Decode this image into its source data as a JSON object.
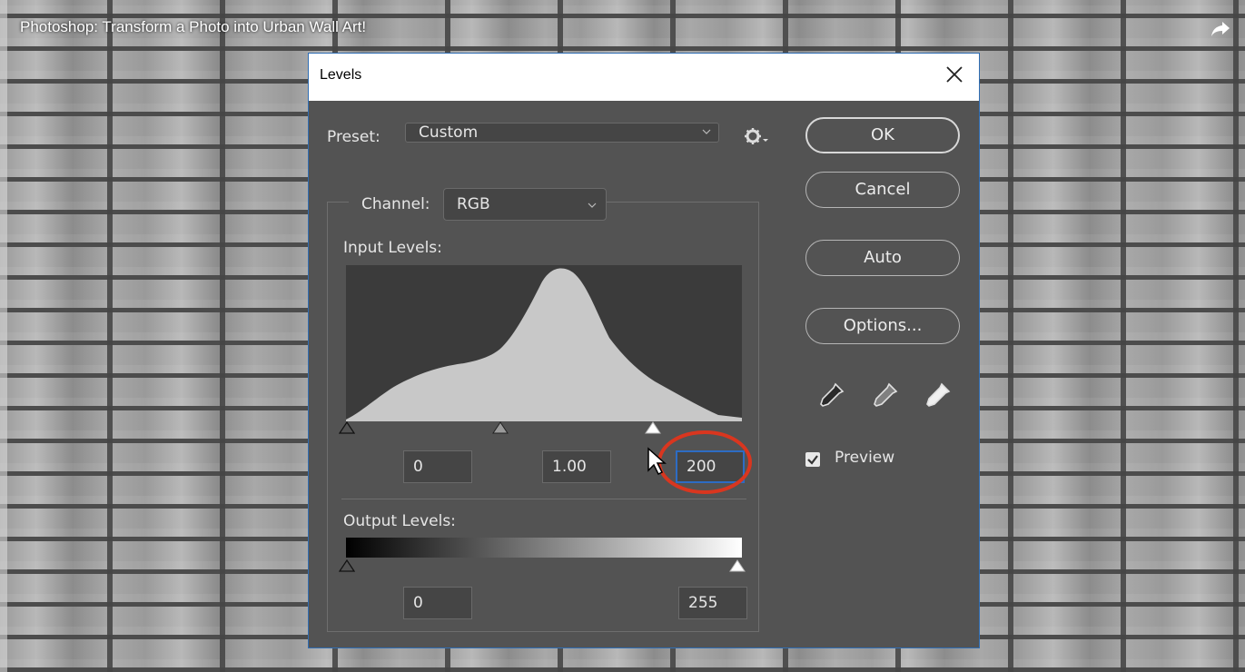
{
  "video": {
    "title": "Photoshop: Transform a Photo into Urban Wall Art!"
  },
  "dialog": {
    "title": "Levels",
    "preset_label": "Preset:",
    "preset_value": "Custom",
    "channel_label": "Channel:",
    "channel_value": "RGB",
    "input_levels_label": "Input Levels:",
    "input_black": "0",
    "input_gamma": "1.00",
    "input_white": "200",
    "output_levels_label": "Output Levels:",
    "output_black": "0",
    "output_white": "255",
    "buttons": {
      "ok": "OK",
      "cancel": "Cancel",
      "auto": "Auto",
      "options": "Options..."
    },
    "preview_label": "Preview",
    "preview_checked": true
  },
  "colors": {
    "dialog_bg": "#535353",
    "histogram_fill": "#c8c8c8",
    "annotation_circle": "#d9361f",
    "focus_border": "#2d6cc4"
  },
  "icons": [
    "close-icon",
    "gear-icon",
    "chevron-down-icon",
    "share-icon",
    "black-eyedropper-icon",
    "gray-eyedropper-icon",
    "white-eyedropper-icon",
    "checkbox-icon",
    "cursor-icon"
  ]
}
